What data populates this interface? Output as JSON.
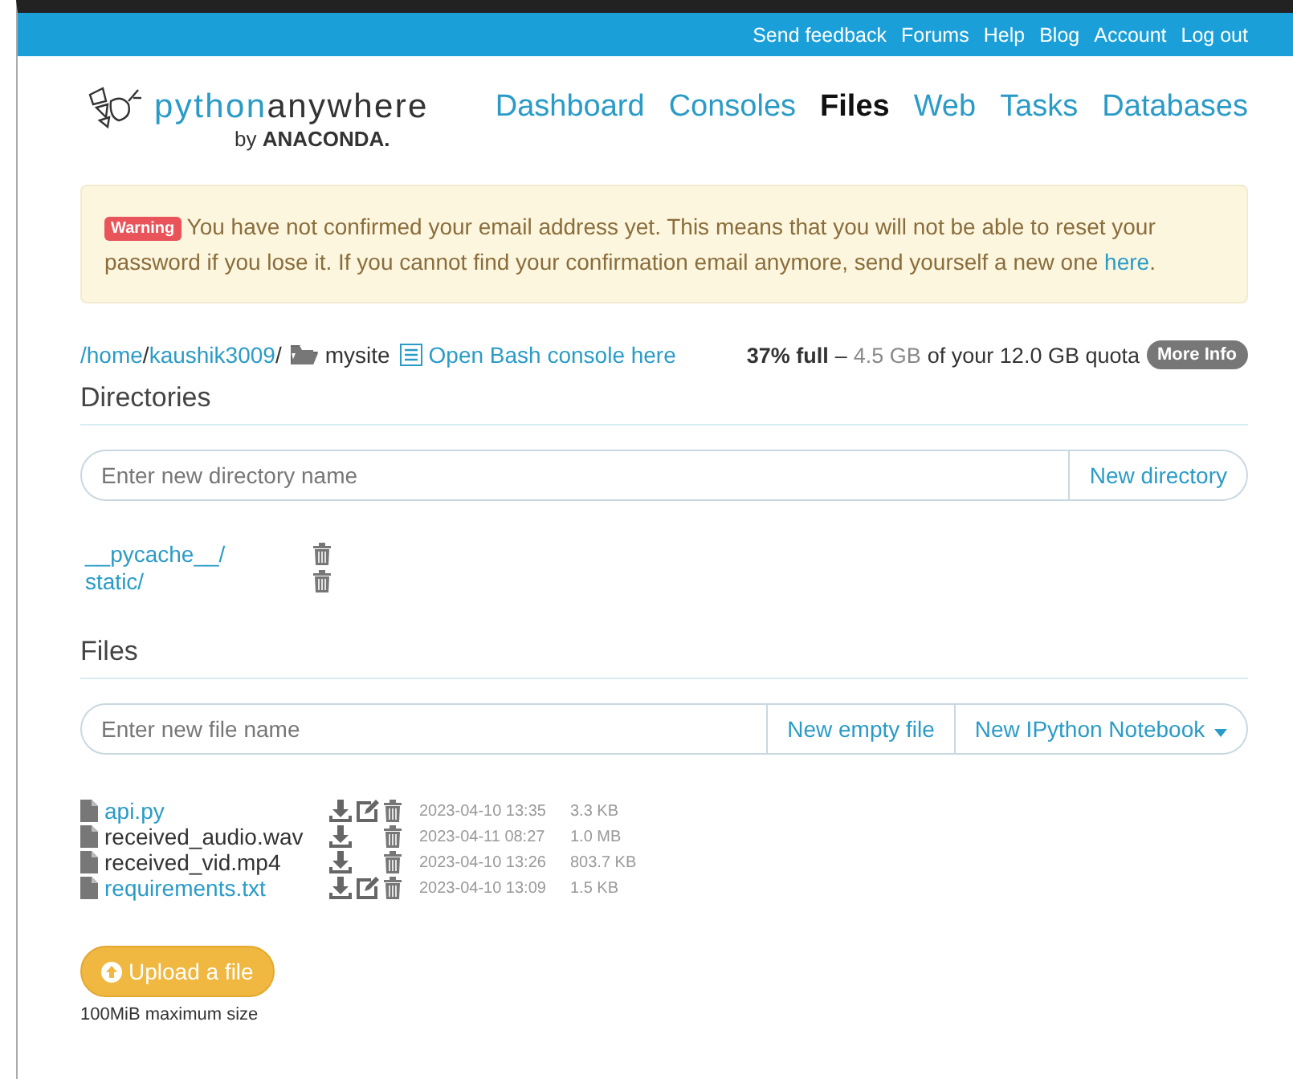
{
  "top_links": [
    "Send feedback",
    "Forums",
    "Help",
    "Blog",
    "Account",
    "Log out"
  ],
  "logo": {
    "name_light": "python",
    "name_dark": "anywhere",
    "by": "by",
    "company": "ANACONDA."
  },
  "nav": [
    {
      "label": "Dashboard",
      "selected": false
    },
    {
      "label": "Consoles",
      "selected": false
    },
    {
      "label": "Files",
      "selected": true
    },
    {
      "label": "Web",
      "selected": false
    },
    {
      "label": "Tasks",
      "selected": false
    },
    {
      "label": "Databases",
      "selected": false
    }
  ],
  "warning": {
    "badge": "Warning",
    "text": "You have not confirmed your email address yet. This means that you will not be able to reset your password if you lose it. If you cannot find your confirmation email anymore, send yourself a new one",
    "link": "here",
    "end": "."
  },
  "path": [
    {
      "text": "/home",
      "kind": "link"
    },
    {
      "text": "/",
      "kind": "plain"
    },
    {
      "text": "kaushik3009",
      "kind": "link"
    },
    {
      "text": "/",
      "kind": "plain"
    }
  ],
  "folder": "mysite",
  "bash_link": "Open Bash console here",
  "quota": {
    "percent": "37% full",
    "dash": "–",
    "used": "4.5 GB",
    "total": "of your 12.0 GB quota",
    "more_info": "More Info"
  },
  "directories": {
    "heading": "Directories",
    "placeholder": "Enter new directory name",
    "button": "New directory",
    "items": [
      "__pycache__/",
      "static/"
    ]
  },
  "files": {
    "heading": "Files",
    "placeholder": "Enter new file name",
    "buttons": [
      "New empty file",
      "New IPython Notebook"
    ],
    "items": [
      {
        "name": "api.py",
        "editable": true,
        "date": "2023-04-10 13:35",
        "size": "3.3 KB"
      },
      {
        "name": "received_audio.wav",
        "editable": false,
        "date": "2023-04-11 08:27",
        "size": "1.0 MB"
      },
      {
        "name": "received_vid.mp4",
        "editable": false,
        "date": "2023-04-10 13:26",
        "size": "803.7 KB"
      },
      {
        "name": "requirements.txt",
        "editable": true,
        "date": "2023-04-10 13:09",
        "size": "1.5 KB"
      }
    ]
  },
  "upload": {
    "button": "Upload a file",
    "note": "100MiB maximum size"
  }
}
